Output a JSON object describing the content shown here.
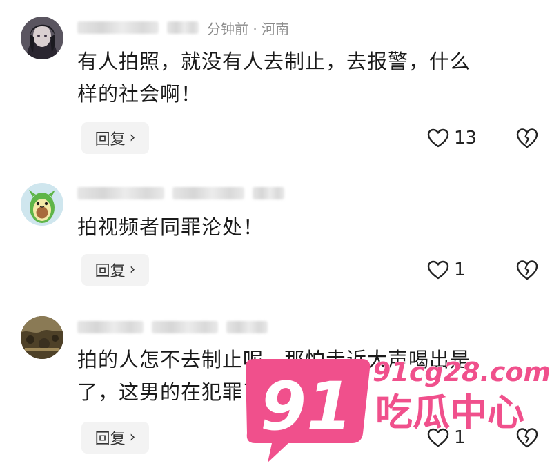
{
  "comments": [
    {
      "time_location": "分钟前 · 河南",
      "text_line1": "有人拍照，就没有人去制止，去报警，什么",
      "text_line2": "样的社会啊！",
      "reply_label": "回复",
      "likes": "13"
    },
    {
      "time_location": "",
      "text_line1": "拍视频者同罪沦处！",
      "text_line2": "",
      "reply_label": "回复",
      "likes": "1"
    },
    {
      "time_location": "",
      "text_line1": "拍的人怎不去制止呢，那怕走近大声喝出是",
      "text_line2": "了，这男的在犯罪了",
      "reply_label": "回复",
      "likes": "1"
    }
  ],
  "icons": {
    "like": "heart-outline-icon",
    "dislike": "broken-heart-icon",
    "reply_chevron": "chevron-right-icon"
  },
  "watermark": {
    "logo_number": "91",
    "site": "91cg28.com",
    "tagline": "吃瓜中心",
    "color": "#f0508c"
  }
}
